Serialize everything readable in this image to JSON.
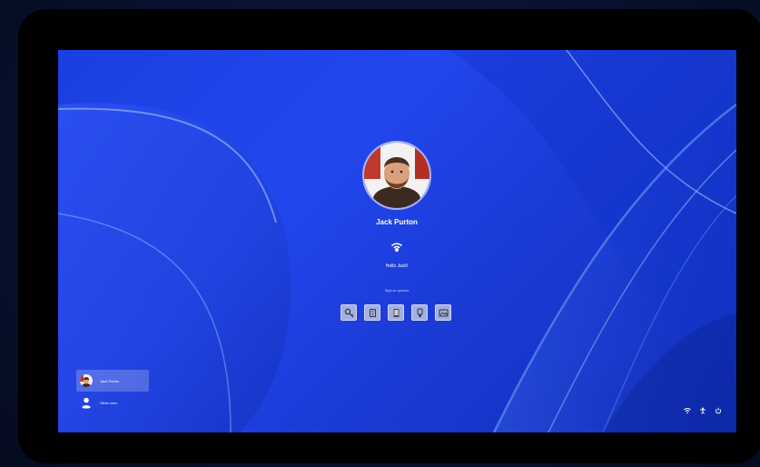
{
  "lock_screen": {
    "user_name": "Jack Purton",
    "greeting": "Hello Jack!",
    "signin_options_label": "Sign-in options",
    "signin_options": [
      {
        "icon": "key-icon"
      },
      {
        "icon": "pin-icon"
      },
      {
        "icon": "phone-icon"
      },
      {
        "icon": "security-key-icon"
      },
      {
        "icon": "picture-password-icon"
      }
    ]
  },
  "user_switcher": {
    "users": [
      {
        "label": "Jack Purton",
        "active": true
      },
      {
        "label": "Other user",
        "active": false
      }
    ]
  },
  "system_tray": {
    "icons": [
      "wifi-icon",
      "accessibility-icon",
      "power-icon"
    ]
  },
  "colors": {
    "accent": "#2347ef",
    "backdrop": "#0b1433"
  }
}
